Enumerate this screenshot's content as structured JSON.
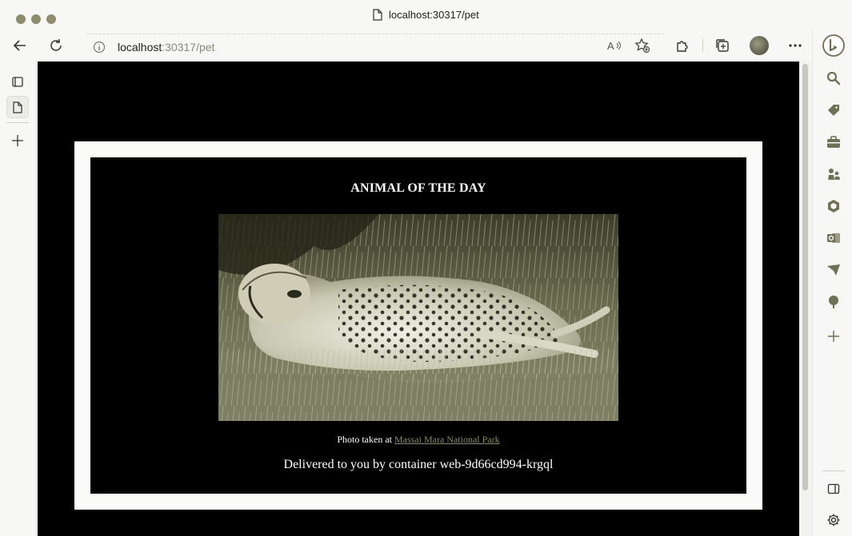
{
  "browser": {
    "tab_title": "localhost:30317/pet",
    "url_host": "localhost",
    "url_rest": ":30317/pet"
  },
  "page": {
    "heading": "ANIMAL OF THE DAY",
    "photo_alt": "Cheetah lying in the grass",
    "caption_prefix": "Photo taken at ",
    "caption_link": "Massai Mara National Park",
    "delivered": "Delivered to you by container web-9d66cd994-krgql"
  },
  "icons": {
    "back": "back-arrow-icon",
    "refresh": "refresh-icon",
    "info": "info-icon",
    "read_aloud": "read-aloud-icon",
    "favorite": "add-favorite-icon",
    "extensions": "extensions-icon",
    "collections": "collections-icon",
    "more": "more-icon",
    "bing": "bing-icon"
  },
  "colors": {
    "accent": "#6f7055",
    "page_bg": "#000000",
    "frame": "#fafaf8",
    "link": "#8a8a6c"
  }
}
